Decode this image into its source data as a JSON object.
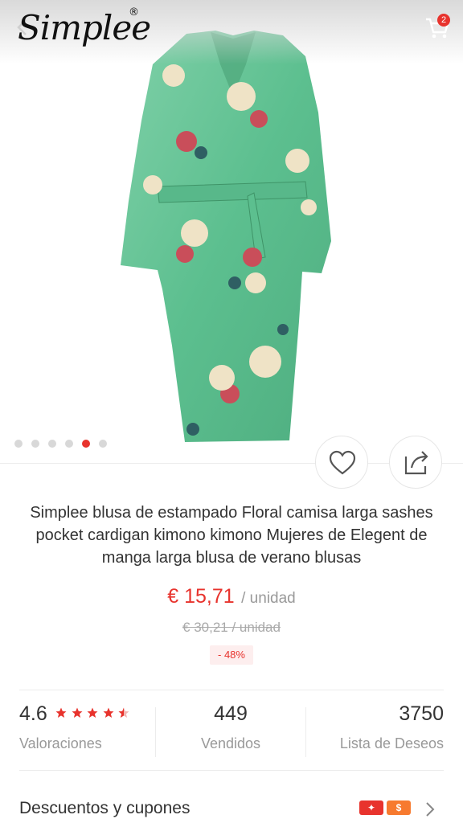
{
  "header": {
    "logo": "Simplee",
    "logo_mark": "®",
    "cart_count": "2",
    "back_icon": "chevron-left-icon",
    "cart_icon": "cart-icon"
  },
  "gallery": {
    "total_images": 6,
    "active_index": 4,
    "favorite_icon": "heart-icon",
    "share_icon": "share-icon"
  },
  "product": {
    "title": "Simplee blusa de estampado Floral camisa larga sashes pocket cardigan kimono kimono Mujeres de Elegent de manga larga blusa de verano blusas",
    "price": "€ 15,71",
    "unit": "/ unidad",
    "old_price": "€ 30,21  / unidad",
    "discount": "- 48%"
  },
  "stats": {
    "rating": "4.6",
    "rating_label": "Valoraciones",
    "sold": "449",
    "sold_label": "Vendidos",
    "wishlist": "3750",
    "wishlist_label": "Lista de Deseos"
  },
  "coupons": {
    "label": "Descuentos y cupones",
    "icon_1": "✦",
    "icon_2": "$"
  },
  "colors": {
    "accent": "#e8332d",
    "kimono_green": "#6cc59a"
  }
}
